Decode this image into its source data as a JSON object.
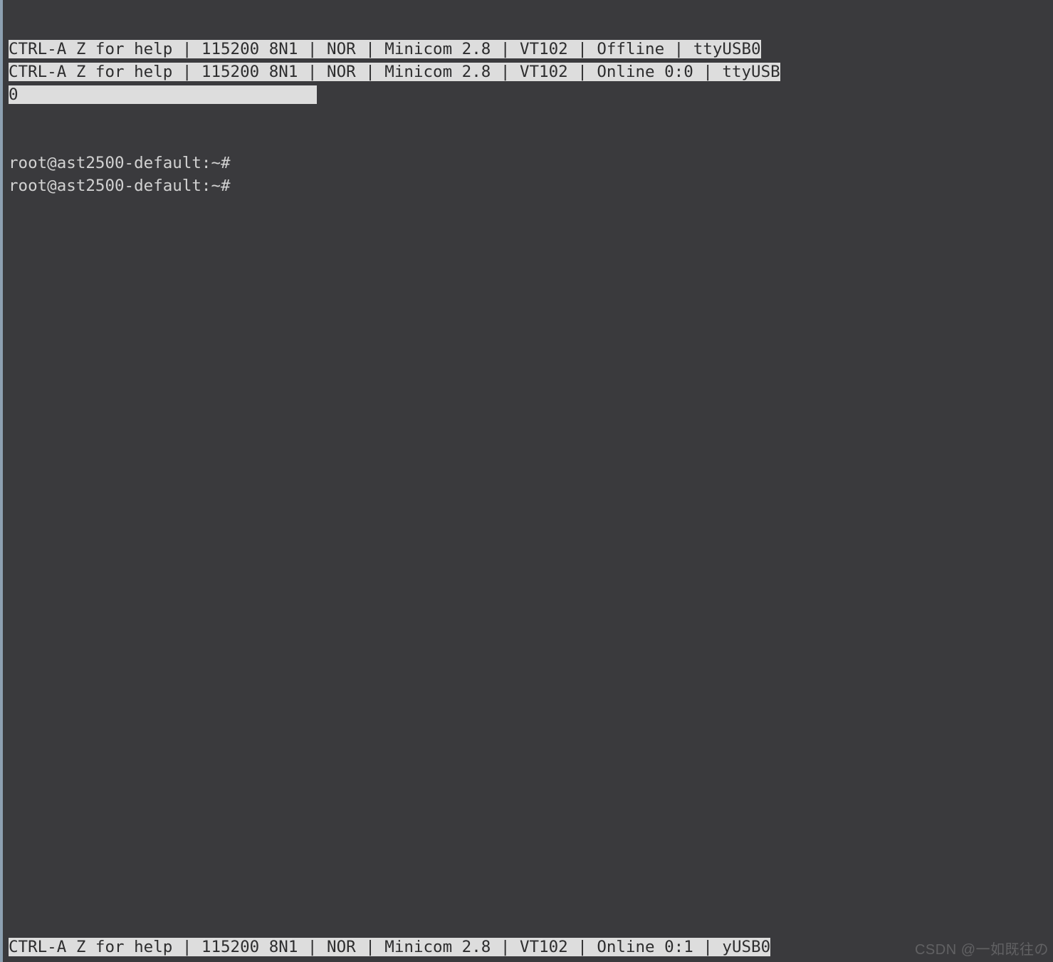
{
  "status_lines": {
    "line1": "CTRL-A Z for help | 115200 8N1 | NOR | Minicom 2.8 | VT102 | Offline | ttyUSB0",
    "line2_part1": "CTRL-A Z for help | 115200 8N1 | NOR | Minicom 2.8 | VT102 | Online 0:0 | ttyUSB",
    "line2_part2": "0                               "
  },
  "prompts": {
    "prompt1": "root@ast2500-default:~#",
    "prompt2": "root@ast2500-default:~#"
  },
  "status_bottom": "CTRL-A Z for help | 115200 8N1 | NOR | Minicom 2.8 | VT102 | Online 0:1 | yUSB0",
  "watermark": "CSDN @一如既往の"
}
